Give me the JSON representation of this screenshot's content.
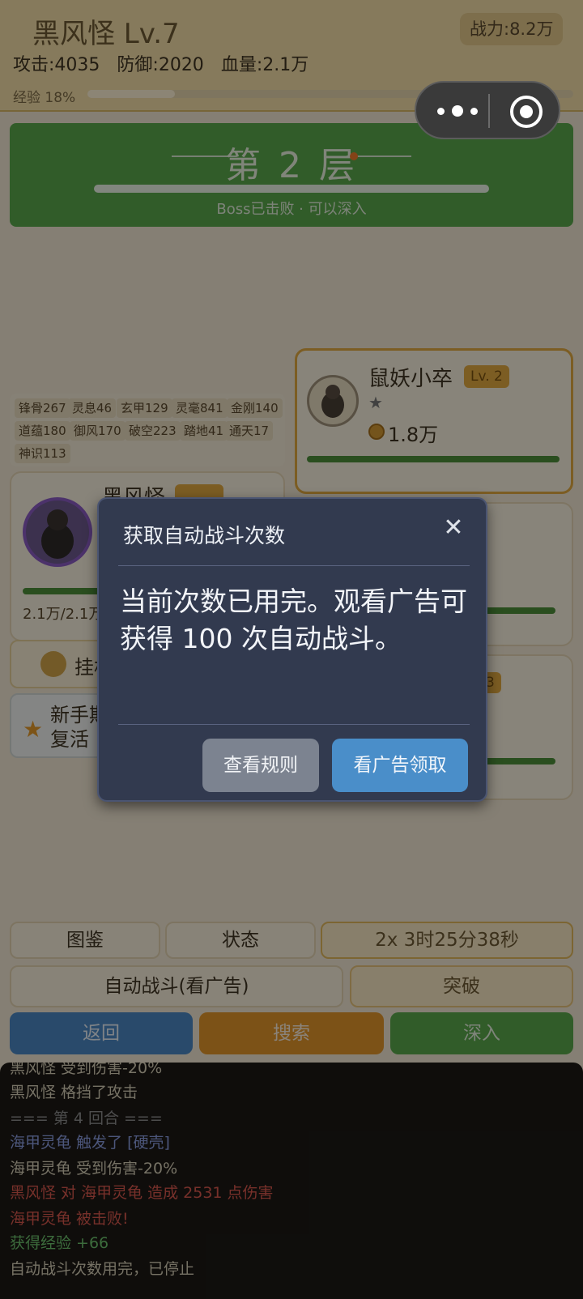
{
  "header": {
    "title": "黑风怪 Lv.7",
    "power": "战力:8.2万",
    "stats": {
      "attack": "攻击:4035",
      "defense": "防御:2020",
      "hp": "血量:2.1万"
    },
    "exp_label": "经验 18%",
    "exp_progress": 0.18
  },
  "floor": {
    "title": "第 2 层",
    "status": "Boss已击败 · 可以深入"
  },
  "stat_chips": [
    "锋骨267",
    "灵息46",
    "玄甲129",
    "灵毫841",
    "金刚140",
    "道蕴180",
    "御风170",
    "破空223",
    "踏地41",
    "通天17",
    "神识113"
  ],
  "enemy": {
    "name": "鼠妖小卒",
    "level": "Lv. 2",
    "stars": "★",
    "power": "1.8万",
    "hp_fraction": 1.0
  },
  "player_card": {
    "name": "黑风怪",
    "hp_text": "2.1万/2.1万"
  },
  "card_r3_level": "3",
  "idle": {
    "label": "挂机"
  },
  "novice": {
    "line1": "新手期",
    "line2": "复活"
  },
  "buttons": {
    "codex": "图鉴",
    "status": "状态",
    "timer": "2x 3时25分38秒",
    "auto_battle": "自动战斗(看广告)",
    "breakthrough": "突破",
    "back": "返回",
    "search": "搜索",
    "deeper": "深入"
  },
  "log": [
    {
      "text": "黑风怪 受到伤害-20%",
      "color": "#d8cfb8"
    },
    {
      "text": "黑风怪 格挡了攻击",
      "color": "#d8cfb8"
    },
    {
      "text": "=== 第 4 回合 ===",
      "color": "#8d8d8d"
    },
    {
      "text": "海甲灵龟 触发了 [硬壳]",
      "color": "#8a9de0"
    },
    {
      "text": "海甲灵龟 受到伤害-20%",
      "color": "#d8cfb8"
    },
    {
      "text": "黑风怪 对 海甲灵龟 造成 2531 点伤害",
      "color": "#d9584e"
    },
    {
      "text": "海甲灵龟 被击败!",
      "color": "#d9584e"
    },
    {
      "text": "获得经验 +66",
      "color": "#6dc46d"
    },
    {
      "text": "自动战斗次数用完，已停止",
      "color": "#d8cfb8"
    }
  ],
  "dialog": {
    "title": "获取自动战斗次数",
    "message": "当前次数已用完。观看广告可获得 100 次自动战斗。",
    "rules_button": "查看规则",
    "watch_button": "看广告领取"
  },
  "colors": {
    "accent_green": "#5aa84c",
    "accent_orange": "#e2952a",
    "accent_blue": "#4b88c4",
    "dialog_bg": "#323a4f"
  }
}
